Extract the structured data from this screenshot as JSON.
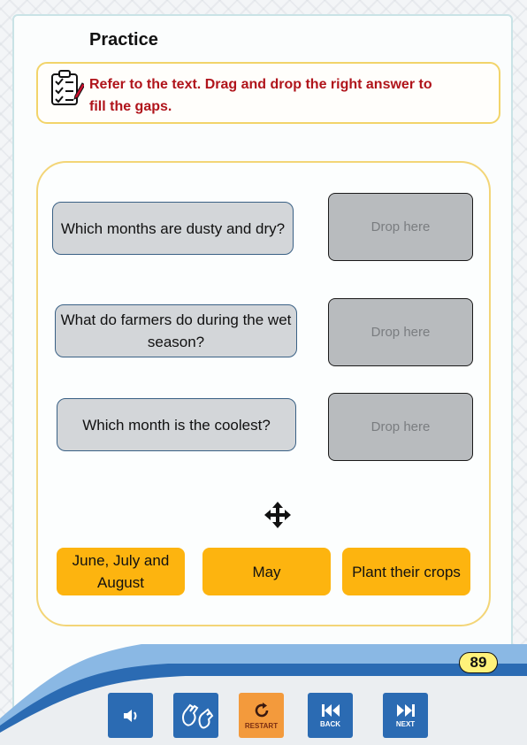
{
  "page": {
    "title": "Practice",
    "page_number": "89"
  },
  "instruction": {
    "text": "Refer to the text. Drag and drop the right answer to fill the gaps."
  },
  "questions": [
    {
      "text": "Which months are dusty and dry?",
      "drop_label": "Drop here"
    },
    {
      "text": "What do farmers do during the wet season?",
      "drop_label": "Drop here"
    },
    {
      "text": "Which month is the coolest?",
      "drop_label": "Drop here"
    }
  ],
  "answers": [
    {
      "text": "June, July and August"
    },
    {
      "text": "May"
    },
    {
      "text": "Plant their crops"
    }
  ],
  "toolbar": {
    "audio_icon": "speaker-icon",
    "sign_icon": "sign-language-icon",
    "restart_label": "RESTART",
    "back_label": "BACK",
    "next_label": "NEXT"
  },
  "colors": {
    "accent_yellow": "#fdb40f",
    "instruction_red": "#b0141b",
    "nav_blue": "#2b6bb3",
    "restart_orange": "#f39a3c"
  }
}
